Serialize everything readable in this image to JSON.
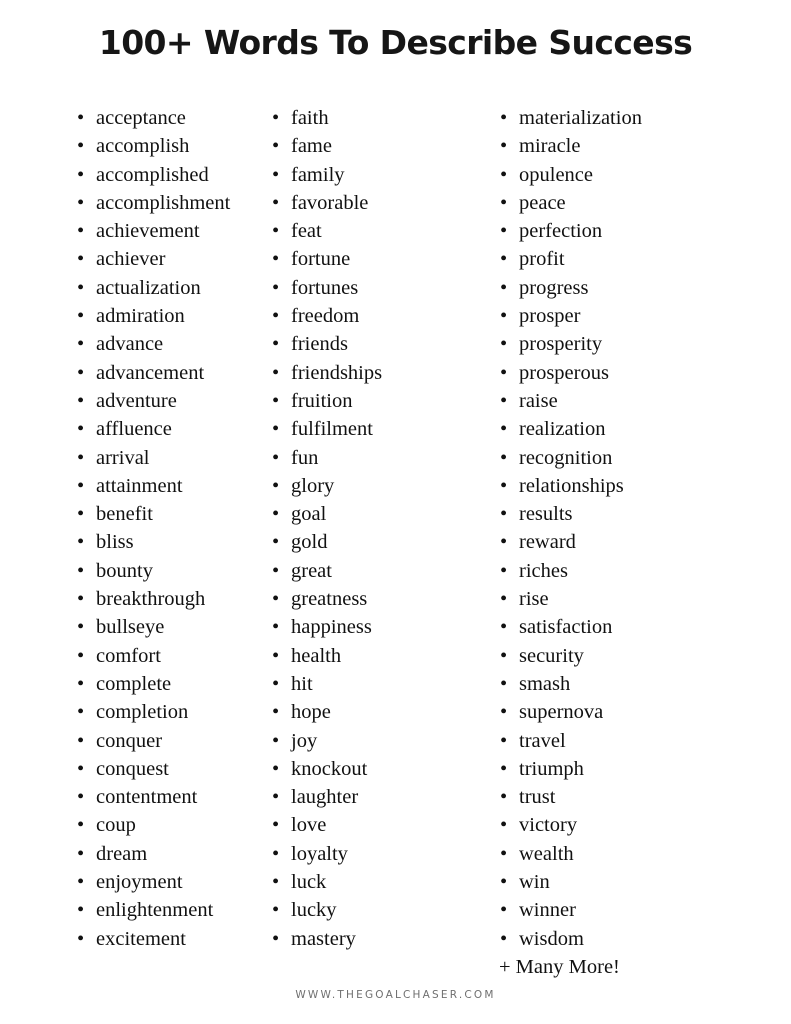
{
  "header": {
    "title": "100+ Words To Describe Success"
  },
  "bullet_glyph": "•",
  "columns": [
    {
      "id": "column-1",
      "items": [
        "acceptance",
        "accomplish",
        "accomplished",
        "accomplishment",
        "achievement",
        "achiever",
        "actualization",
        "admiration",
        "advance",
        "advancement",
        "adventure",
        "affluence",
        "arrival",
        "attainment",
        "benefit",
        "bliss",
        "bounty",
        "breakthrough",
        "bullseye",
        "comfort",
        "complete",
        "completion",
        "conquer",
        "conquest",
        "contentment",
        "coup",
        "dream",
        "enjoyment",
        "enlightenment",
        "excitement"
      ]
    },
    {
      "id": "column-2",
      "items": [
        "faith",
        "fame",
        "family",
        "favorable",
        "feat",
        "fortune",
        "fortunes",
        "freedom",
        "friends",
        "friendships",
        "fruition",
        "fulfilment",
        "fun",
        "glory",
        "goal",
        "gold",
        "great",
        "greatness",
        "happiness",
        "health",
        "hit",
        "hope",
        "joy",
        "knockout",
        "laughter",
        "love",
        "loyalty",
        "luck",
        "lucky",
        "mastery"
      ]
    },
    {
      "id": "column-3",
      "items": [
        "materialization",
        "miracle",
        "opulence",
        "peace",
        "perfection",
        "profit",
        "progress",
        "prosper",
        "prosperity",
        "prosperous",
        "raise",
        "realization",
        "recognition",
        "relationships",
        "results",
        "reward",
        "riches",
        "rise",
        "satisfaction",
        "security",
        "smash",
        "supernova",
        "travel",
        "triumph",
        "trust",
        "victory",
        "wealth",
        "win",
        "winner",
        "wisdom"
      ],
      "trailing_note": "+ Many More!"
    }
  ],
  "footer": {
    "url": "WWW.THEGOALCHASER.COM"
  },
  "colors": {
    "background": "#ffffff",
    "text": "#111111",
    "title": "#161616",
    "footer_text": "#6f6f6f"
  }
}
